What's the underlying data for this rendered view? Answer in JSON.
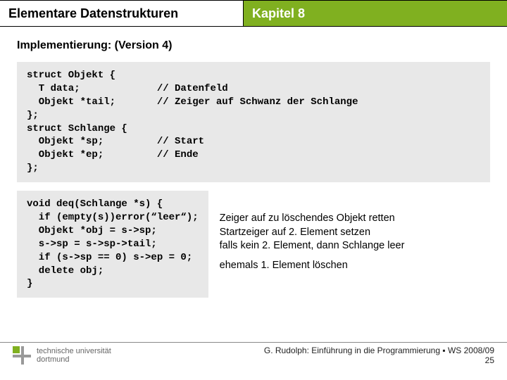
{
  "header": {
    "left": "Elementare Datenstrukturen",
    "right": "Kapitel 8"
  },
  "subtitle": "Implementierung: (Version 4)",
  "code1": "struct Objekt {\n  T data;             // Datenfeld\n  Objekt *tail;       // Zeiger auf Schwanz der Schlange\n};\nstruct Schlange {\n  Objekt *sp;         // Start\n  Objekt *ep;         // Ende\n};",
  "code2": "void deq(Schlange *s) {\n  if (empty(s))error(“leer“);\n  Objekt *obj = s->sp;\n  s->sp = s->sp->tail;\n  if (s->sp == 0) s->ep = 0;\n  delete obj;\n}",
  "notes": {
    "l1": "Zeiger auf zu löschendes Objekt retten",
    "l2": "Startzeiger auf 2. Element setzen",
    "l3": "falls kein 2. Element, dann Schlange leer",
    "l4": "ehemals 1. Element löschen"
  },
  "footer": {
    "uni1": "technische universität",
    "uni2": "dortmund",
    "credit": "G. Rudolph: Einführung in die Programmierung ▪ WS 2008/09",
    "page": "25"
  }
}
